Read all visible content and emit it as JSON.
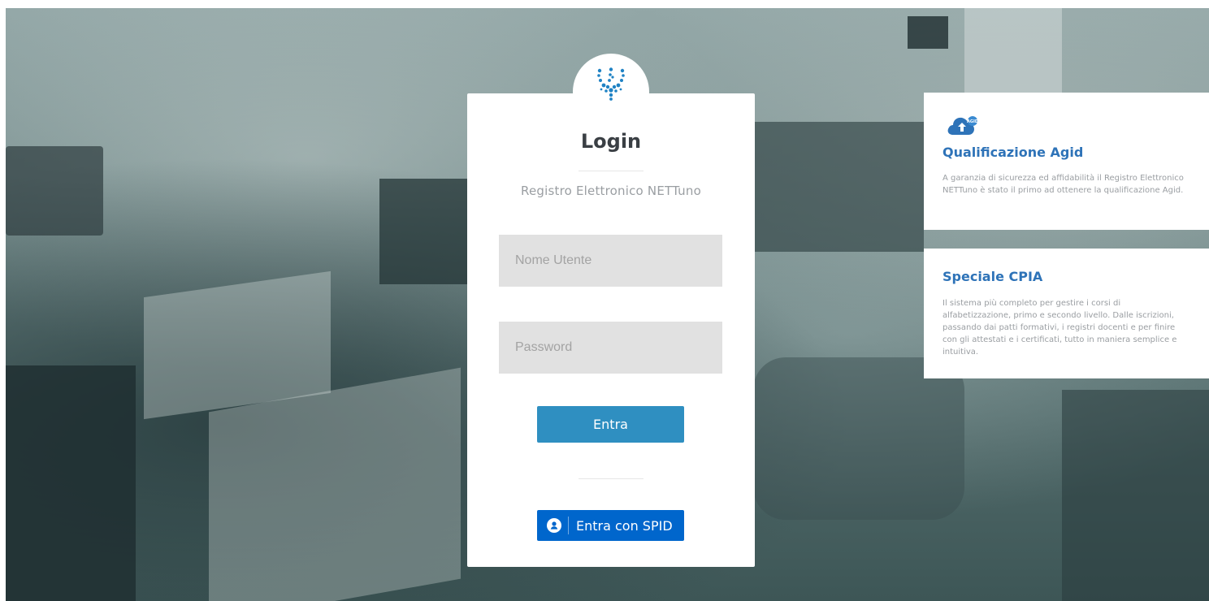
{
  "login": {
    "title": "Login",
    "subtitle": "Registro Elettronico NETTuno",
    "username_placeholder": "Nome Utente",
    "password_placeholder": "Password",
    "submit_label": "Entra",
    "spid_label": "Entra con SPID"
  },
  "info_cards": [
    {
      "icon": "cloud-agid-icon",
      "title": "Qualificazione Agid",
      "text": "A garanzia di sicurezza ed affidabilità il Registro Elettronico NETTuno è stato il primo ad ottenere la qualificazione Agid."
    },
    {
      "title": "Speciale CPIA",
      "text": "Il sistema più completo per gestire i corsi di alfabetizzazione, primo e secondo livello. Dalle iscrizioni, passando dai patti formativi, i registri docenti e per finire con gli attestati e i certificati, tutto in maniera semplice e intuitiva."
    }
  ],
  "colors": {
    "primary_button": "#2f8fc1",
    "spid_button": "#0066cc",
    "card_title": "#2e73b8",
    "input_bg": "#e1e1e1"
  }
}
